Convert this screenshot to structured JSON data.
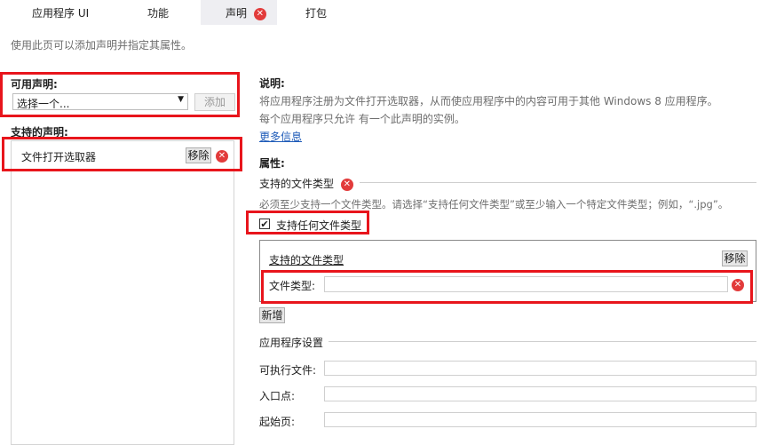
{
  "tabs": [
    {
      "label": "应用程序 UI"
    },
    {
      "label": "功能"
    },
    {
      "label": "声明"
    },
    {
      "label": "打包"
    }
  ],
  "intro": "使用此页可以添加声明并指定其属性。",
  "left": {
    "available_label": "可用声明:",
    "select_value": "选择一个...",
    "add_label": "添加",
    "supported_label": "支持的声明:",
    "item_label": "文件打开选取器",
    "remove_label": "移除"
  },
  "right": {
    "desc_heading": "说明:",
    "desc_line1": "将应用程序注册为文件打开选取器，从而使应用程序中的内容可用于其他 Windows 8 应用程序。",
    "desc_line2": "每个应用程序只允许 有一个此声明的实例。",
    "more_info": "更多信息",
    "props_heading": "属性:",
    "filetypes_heading": "支持的文件类型",
    "filetypes_hint": "必须至少支持一个文件类型。请选择“支持任何文件类型”或至少输入一个特定文件类型；例如，“.jpg”。",
    "any_filetype_label": "支持任何文件类型",
    "any_filetype_checked": true,
    "group_title": "支持的文件类型",
    "group_remove": "移除",
    "filetype_label": "文件类型:",
    "filetype_value": "",
    "new_label": "新增",
    "app_settings_heading": "应用程序设置",
    "exe_label": "可执行文件:",
    "exe_value": "",
    "entry_label": "入口点:",
    "entry_value": "",
    "start_label": "起始页:",
    "start_value": ""
  },
  "colors": {
    "highlight": "#e8151c",
    "error": "#e23b3b",
    "link": "#1e5bb8",
    "tab_active_bg": "#eeeef2"
  },
  "icons": {
    "error": "error-x-icon",
    "dropdown": "chevron-down-icon",
    "checkbox": "checkmark-icon"
  }
}
